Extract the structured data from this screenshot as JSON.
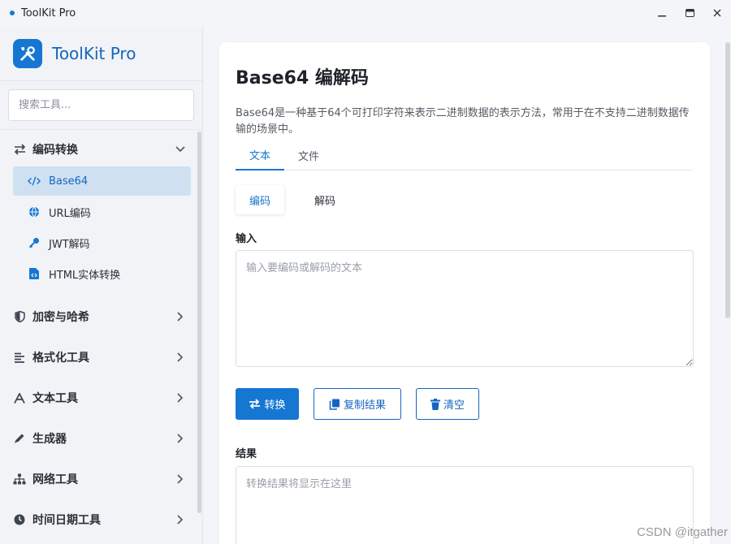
{
  "window": {
    "title": "ToolKit Pro"
  },
  "brand": {
    "name": "ToolKit Pro"
  },
  "search": {
    "placeholder": "搜索工具..."
  },
  "nav": {
    "groups": [
      {
        "label": "编码转换",
        "icon": "arrows-swap-icon",
        "expanded": true,
        "items": [
          {
            "label": "Base64",
            "icon": "code-icon",
            "active": true
          },
          {
            "label": "URL编码",
            "icon": "globe-icon"
          },
          {
            "label": "JWT解码",
            "icon": "key-icon"
          },
          {
            "label": "HTML实体转换",
            "icon": "file-code-icon"
          }
        ]
      },
      {
        "label": "加密与哈希",
        "icon": "shield-icon"
      },
      {
        "label": "格式化工具",
        "icon": "align-left-icon"
      },
      {
        "label": "文本工具",
        "icon": "font-icon"
      },
      {
        "label": "生成器",
        "icon": "pen-icon"
      },
      {
        "label": "网络工具",
        "icon": "network-icon"
      },
      {
        "label": "时间日期工具",
        "icon": "clock-icon"
      }
    ]
  },
  "main": {
    "title": "Base64 编解码",
    "description": "Base64是一种基于64个可打印字符来表示二进制数据的表示方法，常用于在不支持二进制数据传输的场景中。",
    "tabs": [
      {
        "label": "文本",
        "active": true
      },
      {
        "label": "文件"
      }
    ],
    "modes": [
      {
        "label": "编码",
        "active": true
      },
      {
        "label": "解码"
      }
    ],
    "input": {
      "label": "输入",
      "placeholder": "输入要编码或解码的文本",
      "value": ""
    },
    "buttons": {
      "convert": "转换",
      "copy": "复制结果",
      "clear": "清空"
    },
    "result": {
      "label": "结果",
      "placeholder": "转换结果将显示在这里",
      "value": ""
    }
  },
  "watermark": "CSDN @itgather",
  "colors": {
    "accent": "#1677d2",
    "active_bg": "#cfe1f1"
  }
}
